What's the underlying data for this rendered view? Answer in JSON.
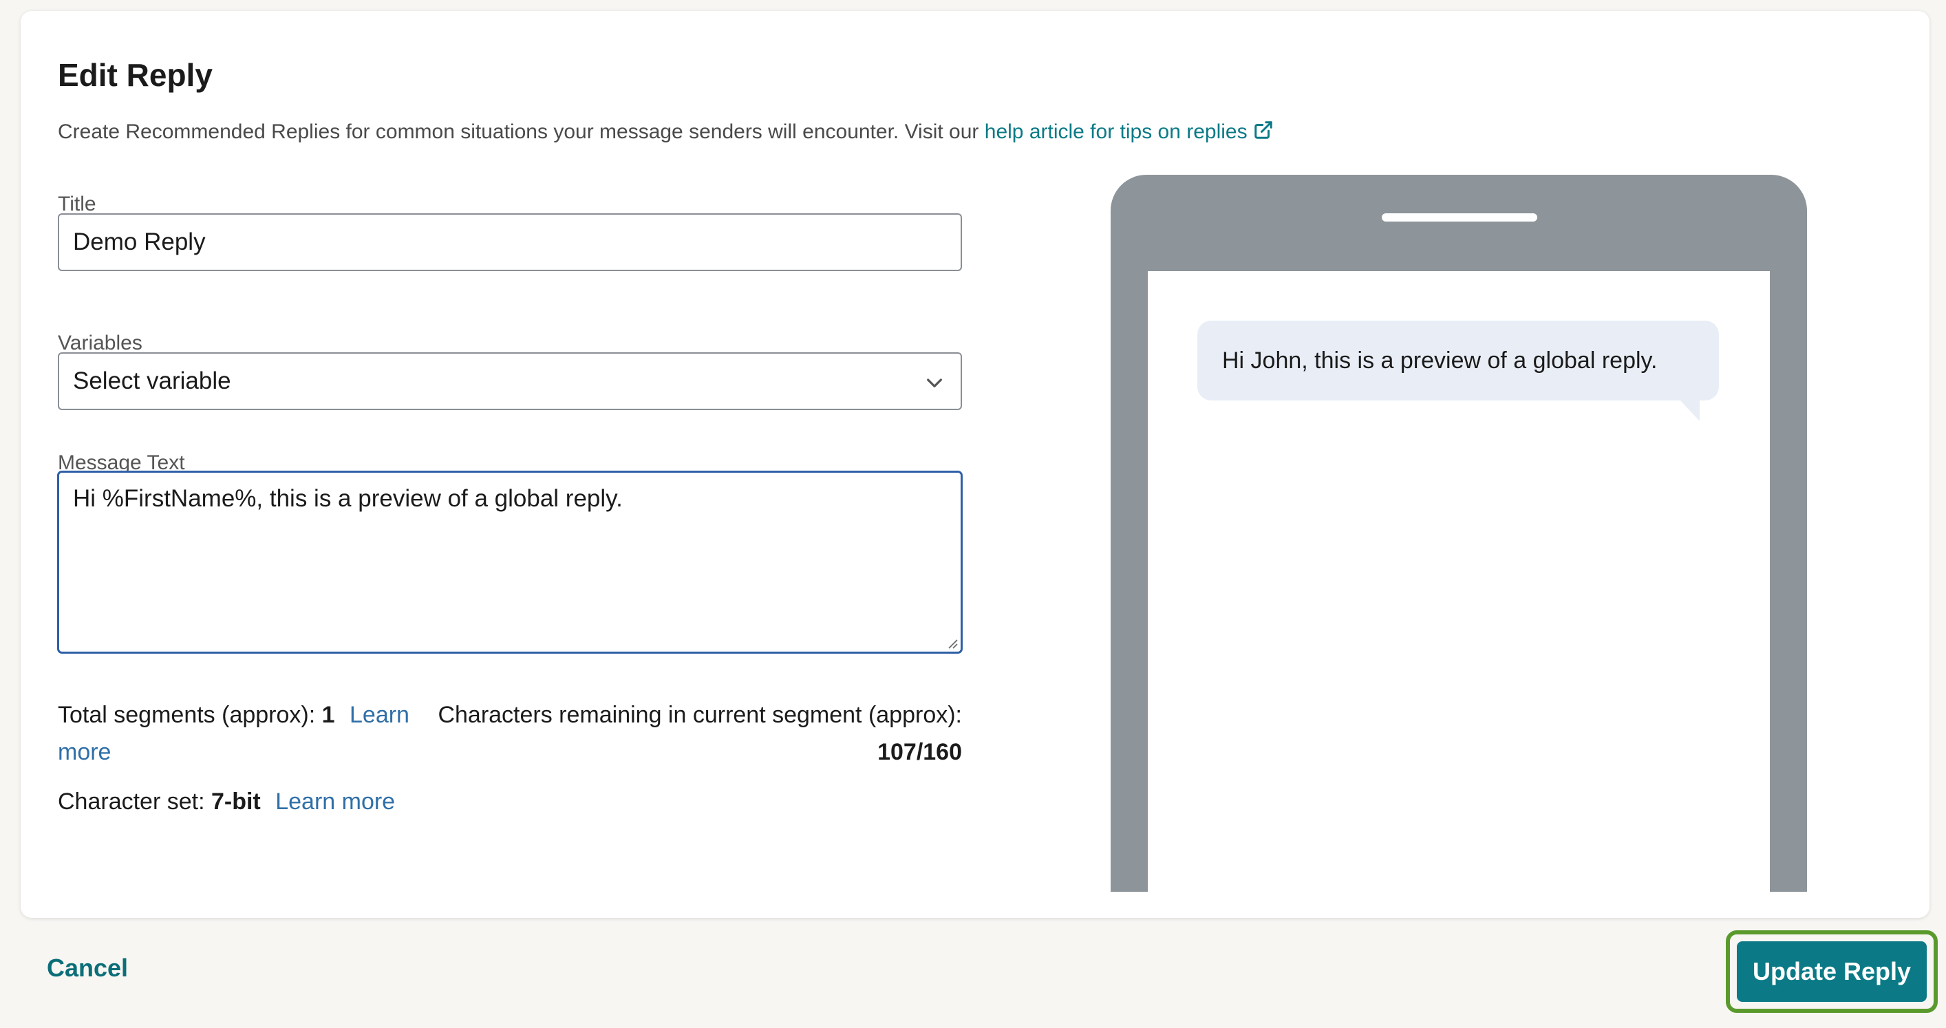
{
  "page": {
    "title": "Edit Reply",
    "description_prefix": "Create Recommended Replies for common situations your message senders will encounter. Visit our",
    "help_link": "help article for tips on replies"
  },
  "form": {
    "title_label": "Title",
    "title_value": "Demo Reply",
    "variables_label": "Variables",
    "variables_value": "Select variable",
    "message_label": "Message Text",
    "message_value": "Hi %FirstName%, this is a preview of a global reply."
  },
  "stats": {
    "segments_label": "Total segments (approx):",
    "segments_value": "1",
    "segments_link_1": "Learn",
    "segments_link_2": "more",
    "remaining_label": "Characters remaining in current segment (approx):",
    "remaining_value": "107/160",
    "charset_label": "Character set:",
    "charset_value": "7-bit",
    "charset_link": "Learn more"
  },
  "preview": {
    "bubble_text": "Hi John, this is a preview of a global reply."
  },
  "footer": {
    "cancel_label": "Cancel",
    "update_label": "Update Reply"
  },
  "colors": {
    "accent": "#0b7a86",
    "link": "#2f6fa8",
    "focus_ring": "#5a9a2c",
    "phone_frame": "#8d949a",
    "bubble": "#e9eef6"
  },
  "icons": {
    "external_link": "external-link-icon",
    "chevron": "chevron-down-icon",
    "resize": "resize-grip-icon"
  }
}
